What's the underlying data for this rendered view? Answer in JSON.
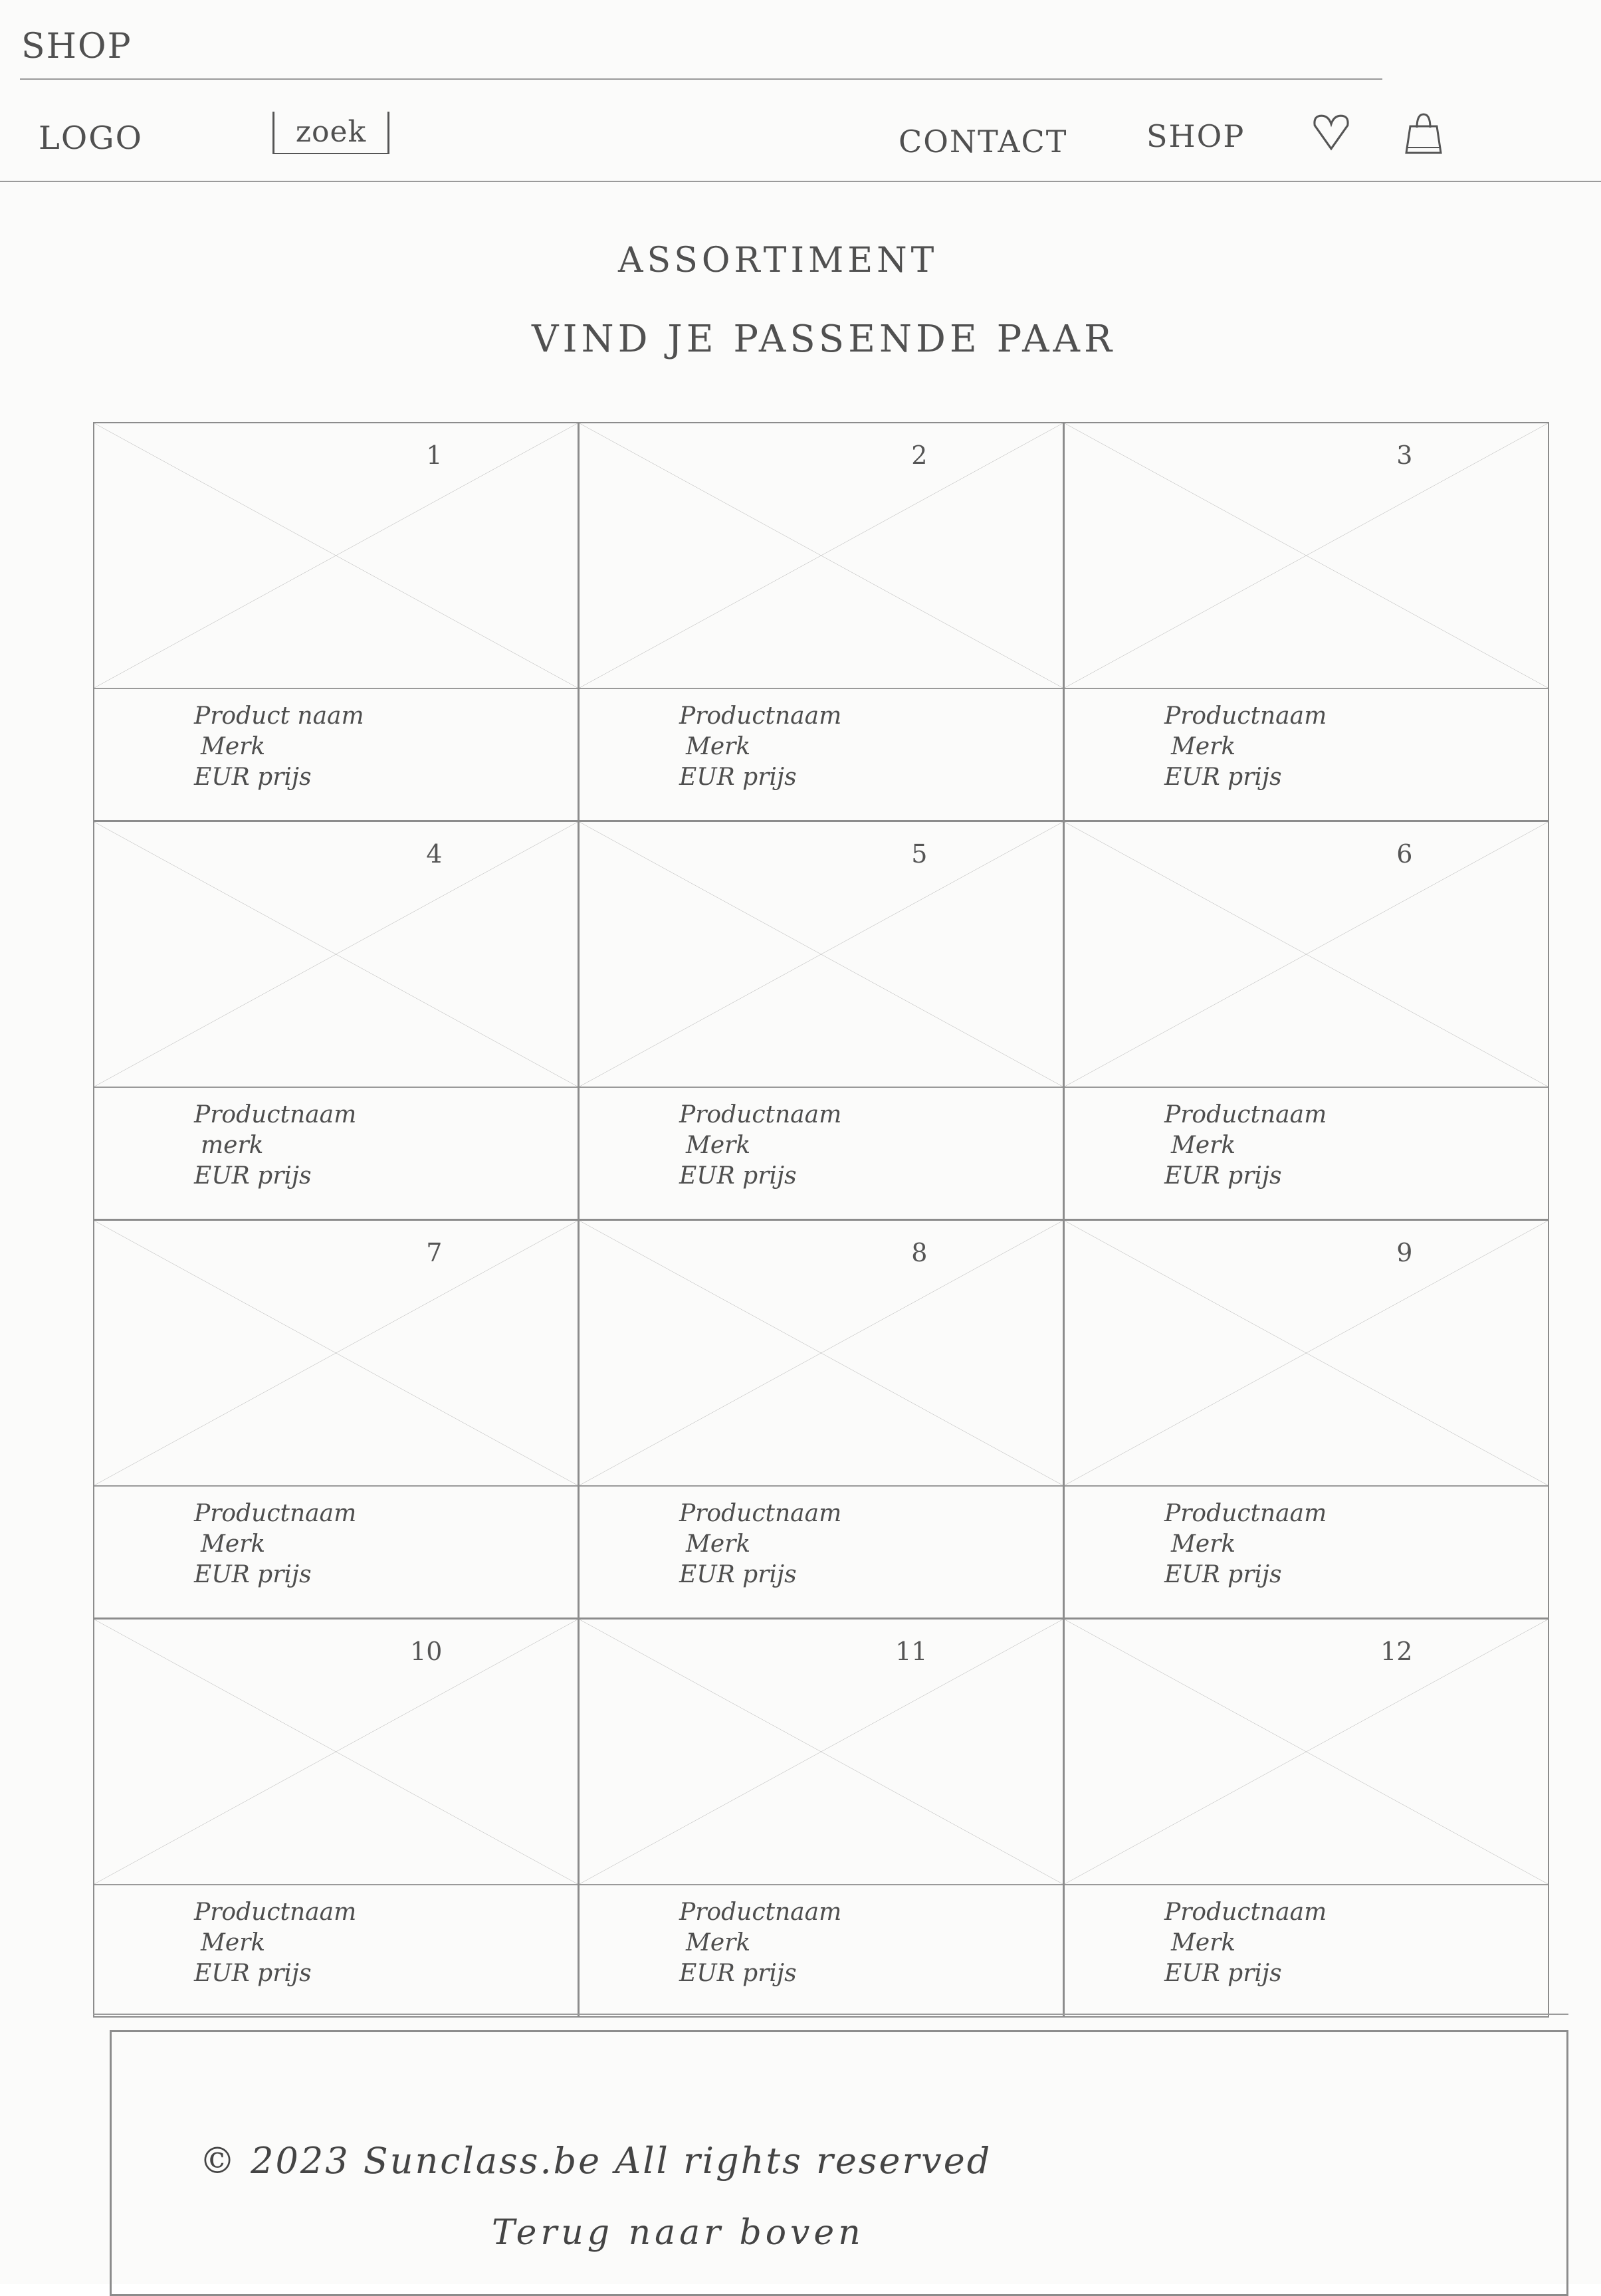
{
  "page": {
    "title": "SHOP"
  },
  "header": {
    "logo": "LOGO",
    "search_label": "zoek",
    "nav": {
      "contact": "CONTACT",
      "shop": "SHOP"
    },
    "icons": [
      "heart-icon",
      "shopping-bag-icon"
    ]
  },
  "main": {
    "heading": "ASSORTIMENT",
    "subheading": "VIND JE PASSENDE PAAR"
  },
  "products": [
    {
      "number": "1",
      "name": "Product naam",
      "brand": "Merk",
      "price": "EUR prijs"
    },
    {
      "number": "2",
      "name": "Productnaam",
      "brand": "Merk",
      "price": "EUR prijs"
    },
    {
      "number": "3",
      "name": "Productnaam",
      "brand": "Merk",
      "price": "EUR prijs"
    },
    {
      "number": "4",
      "name": "Productnaam",
      "brand": "merk",
      "price": "EUR prijs"
    },
    {
      "number": "5",
      "name": "Productnaam",
      "brand": "Merk",
      "price": "EUR prijs"
    },
    {
      "number": "6",
      "name": "Productnaam",
      "brand": "Merk",
      "price": "EUR prijs"
    },
    {
      "number": "7",
      "name": "Productnaam",
      "brand": "Merk",
      "price": "EUR prijs"
    },
    {
      "number": "8",
      "name": "Productnaam",
      "brand": "Merk",
      "price": "EUR prijs"
    },
    {
      "number": "9",
      "name": "Productnaam",
      "brand": "Merk",
      "price": "EUR prijs"
    },
    {
      "number": "10",
      "name": "Productnaam",
      "brand": "Merk",
      "price": "EUR prijs"
    },
    {
      "number": "11",
      "name": "Productnaam",
      "brand": "Merk",
      "price": "EUR prijs"
    },
    {
      "number": "12",
      "name": "Productnaam",
      "brand": "Merk",
      "price": "EUR prijs"
    }
  ],
  "footer": {
    "copyright": "© 2023 Sunclass.be All rights reserved",
    "back_link": "Terug naar boven"
  }
}
